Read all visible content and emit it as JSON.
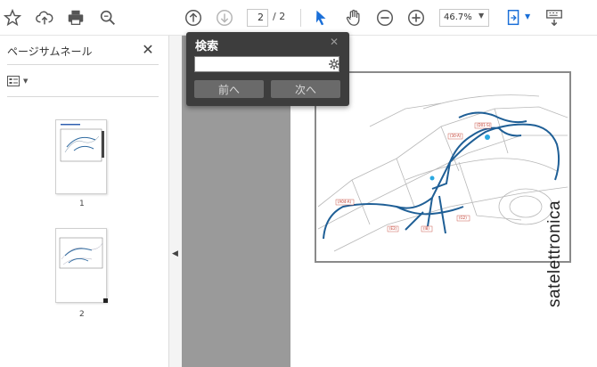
{
  "toolbar": {
    "page_current": "2",
    "page_separator": "/ 2",
    "zoom": "46.7%"
  },
  "sidebar": {
    "title": "ページサムネール",
    "thumbnails": [
      {
        "label": "1"
      },
      {
        "label": "2"
      }
    ]
  },
  "search": {
    "title": "検索",
    "input_value": "",
    "prev_label": "前へ",
    "next_label": "次へ"
  },
  "document": {
    "watermark": "satelettronica",
    "diagram_labels": [
      "(D01-S)",
      "(30-A)",
      "(A04-A)",
      "(E2)",
      "(I8)",
      "(G2)"
    ]
  },
  "colors": {
    "accent": "#1a6fd8",
    "harness": "#1f5f96"
  }
}
